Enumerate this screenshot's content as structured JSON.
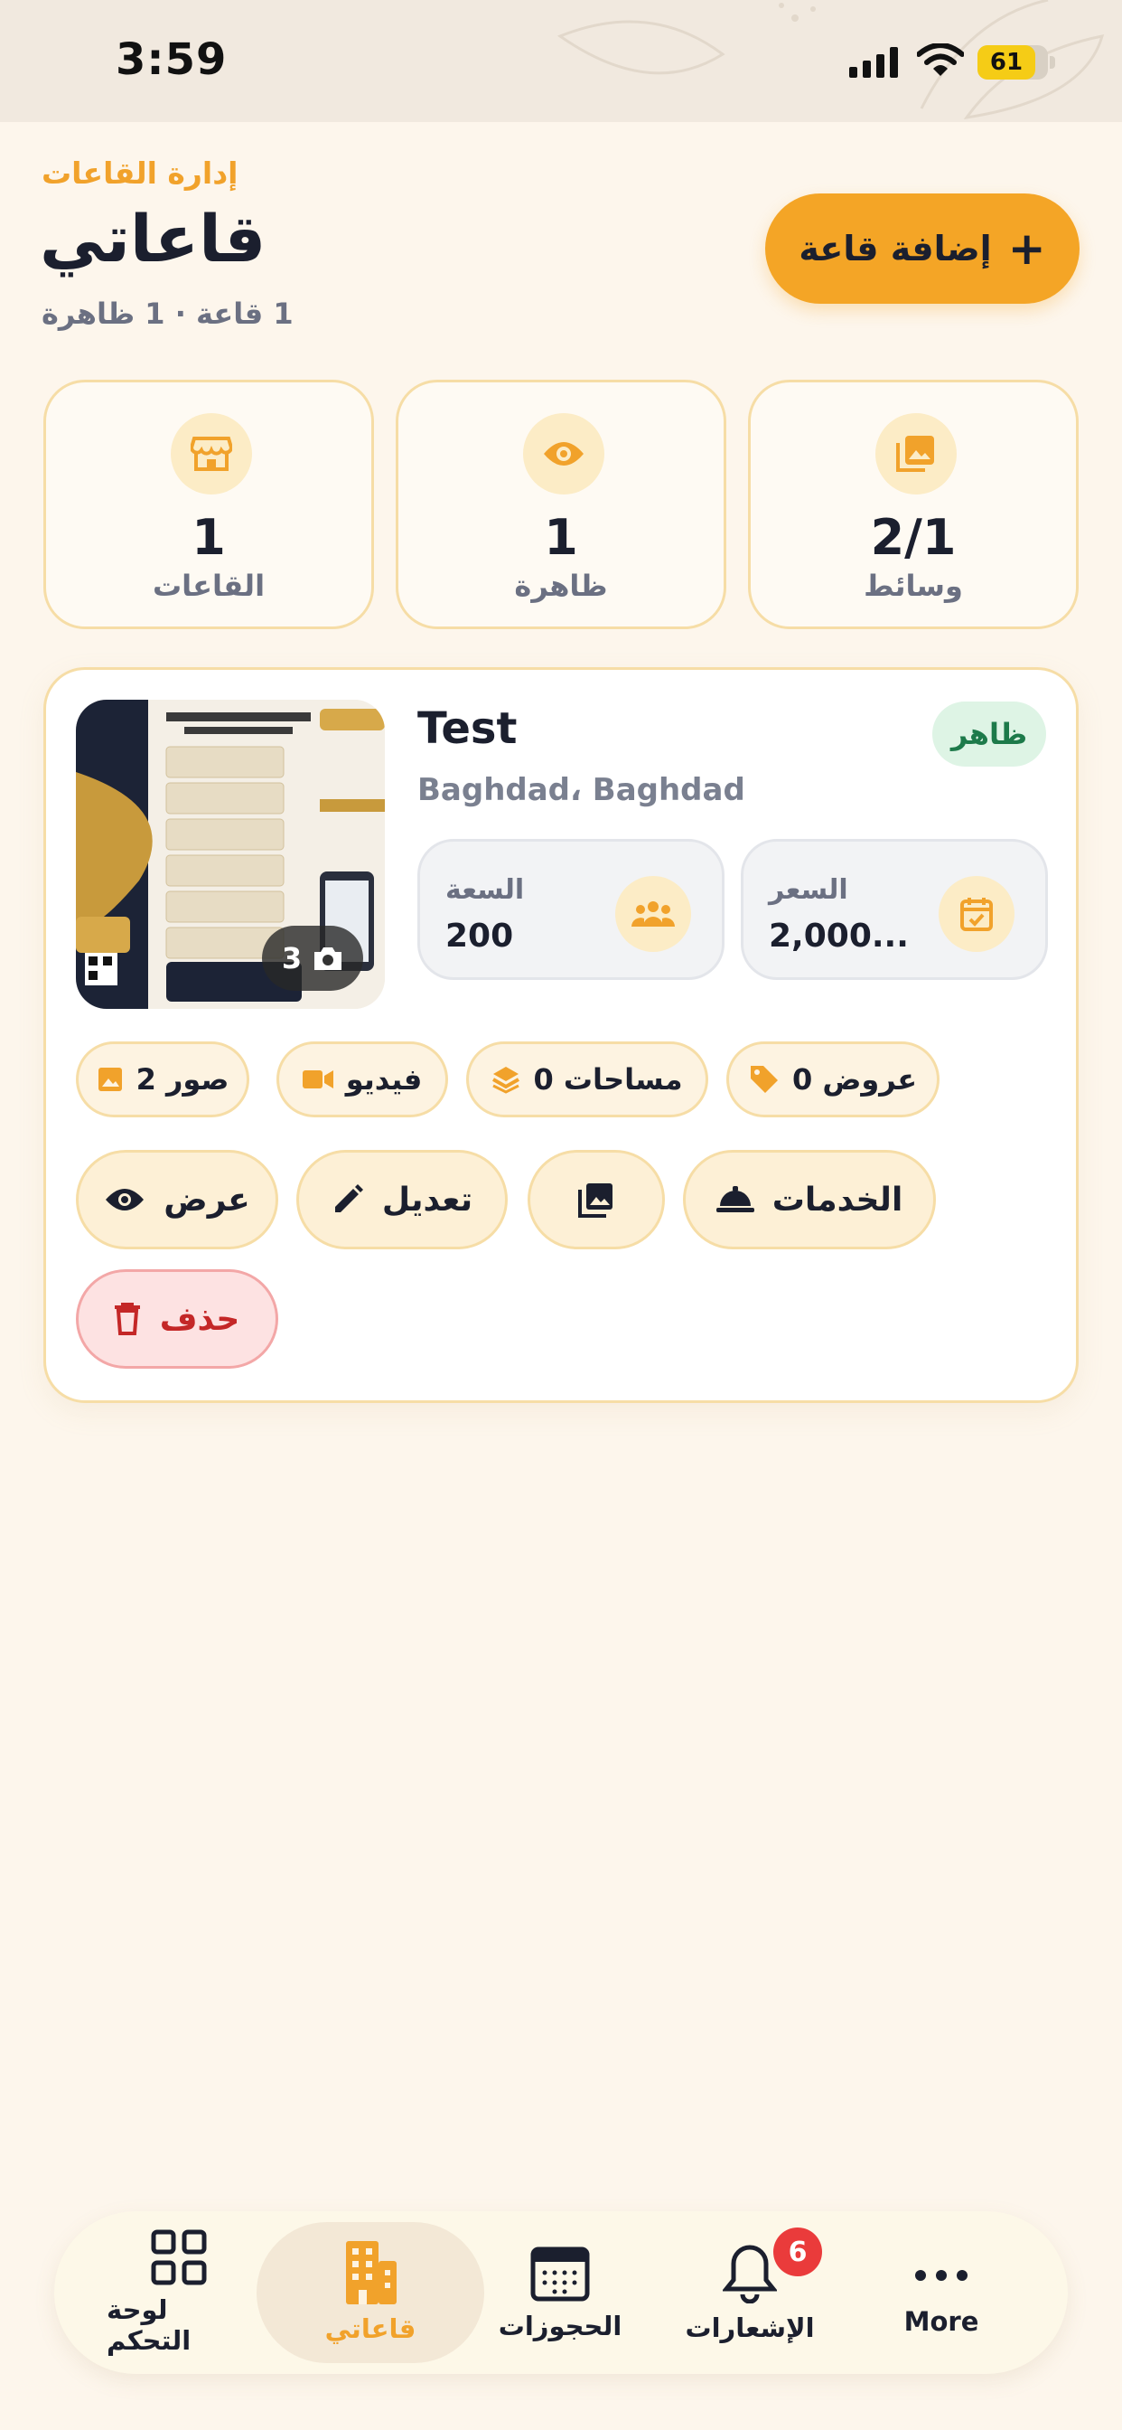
{
  "status_bar": {
    "time": "3:59",
    "battery": "61"
  },
  "header": {
    "eyebrow": "إدارة القاعات",
    "title": "قاعاتي",
    "subtitle": "1 قاعة · 1 ظاهرة",
    "add_button": "إضافة قاعة"
  },
  "stats": [
    {
      "value": "1",
      "label": "القاعات",
      "icon": "store-icon"
    },
    {
      "value": "1",
      "label": "ظاهرة",
      "icon": "eye-icon"
    },
    {
      "value": "2/1",
      "label": "وسائط",
      "icon": "gallery-icon"
    }
  ],
  "hall": {
    "name": "Test",
    "location": "Baghdad، Baghdad",
    "status": "ظاهر",
    "photo_count": "3",
    "capacity_label": "السعة",
    "capacity_value": "200",
    "price_label": "السعر",
    "price_value": "2,000...",
    "chips": {
      "photos": "2 صور",
      "video": "فيديو",
      "spaces": "0 مساحات",
      "offers": "0 عروض"
    },
    "actions": {
      "view": "عرض",
      "edit": "تعديل",
      "services": "الخدمات",
      "delete": "حذف"
    }
  },
  "nav": {
    "dashboard": "لوحة التحكم",
    "halls": "قاعاتي",
    "bookings": "الحجوزات",
    "notifications": "الإشعارات",
    "notifications_badge": "6",
    "more": "More"
  },
  "colors": {
    "accent": "#f4a526",
    "background": "#fdf6ec",
    "visible_green": "#1d7a4a",
    "danger": "#c42727"
  }
}
